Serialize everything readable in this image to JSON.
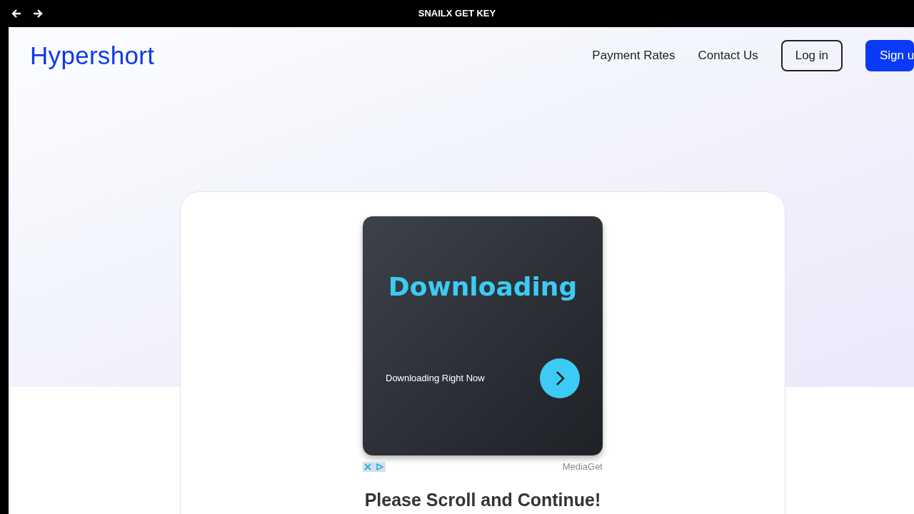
{
  "window": {
    "title": "SNAILX GET KEY"
  },
  "navbar": {
    "logo": "Hypershort",
    "links": [
      "Payment Rates",
      "Contact Us"
    ],
    "buttons": [
      {
        "label": "Log in",
        "kind": "outline"
      },
      {
        "label": "Sign u",
        "kind": "primary"
      }
    ]
  },
  "ad": {
    "headline": "Downloading",
    "subtitle": "Downloading Right Now",
    "advertiser": "MediaGet"
  },
  "heading": "Please Scroll and Continue!"
}
